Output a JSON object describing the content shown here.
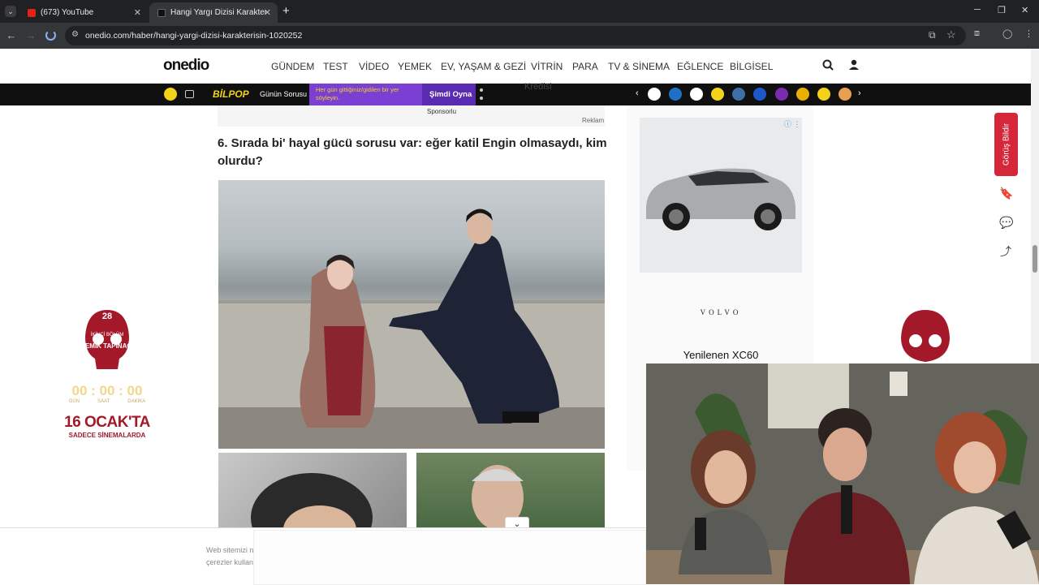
{
  "browser": {
    "tabs": [
      {
        "title": "(673) YouTube",
        "active": false
      },
      {
        "title": "Hangi Yargı Dizisi Karakterisin?",
        "active": true
      }
    ],
    "new_tab": "+",
    "url": "onedio.com/haber/hangi-yargi-dizisi-karakterisin-1020252"
  },
  "site": {
    "logo": "onedio",
    "nav": [
      "GÜNDEM",
      "TEST",
      "VİDEO",
      "YEMEK",
      "EV, YAŞAM & GEZİ",
      "VİTRİN",
      "PARA",
      "TV & SİNEMA",
      "EĞLENCE",
      "BİLGİSEL"
    ]
  },
  "strip": {
    "bilpop": "BİLPOP",
    "gunun_sorusu": "Günün Sorusu",
    "promo_text": "Her gün gittiğiniz/gidilen bir yer söyleyin.",
    "cta": "Şimdi Oyna",
    "behind_text": "Kredisi"
  },
  "ad_labels": {
    "sponsored": "Sponsorlu",
    "reklam": "Reklam"
  },
  "article": {
    "question_title": "6. Sırada bi' hayal gücü sorusu var: eğer katil Engin olmasaydı, kim olurdu?"
  },
  "right_ad": {
    "brand": "VOLVO",
    "model": "Yenilenen XC60"
  },
  "side_ad": {
    "top": "28",
    "subtitle": "İKİNCİ BÖLÜM",
    "title": "KEMİK TAPINAĞI",
    "countdown": "00 : 00 : 00",
    "labels": [
      "GÜN",
      "SAAT",
      "DAKİKA"
    ],
    "date": "16 OCAK'TA",
    "note": "SADECE SİNEMALARDA"
  },
  "feedback": "Görüş Bildir",
  "cookie": {
    "line1": "Web sitemizi n",
    "line2": "çerezler kullanı"
  },
  "colors": {
    "feedback_red": "#d6263a",
    "strip_bg": "#101010",
    "promo_purple": "#7b3fd4",
    "bilpop_yellow": "#f3d21a"
  }
}
